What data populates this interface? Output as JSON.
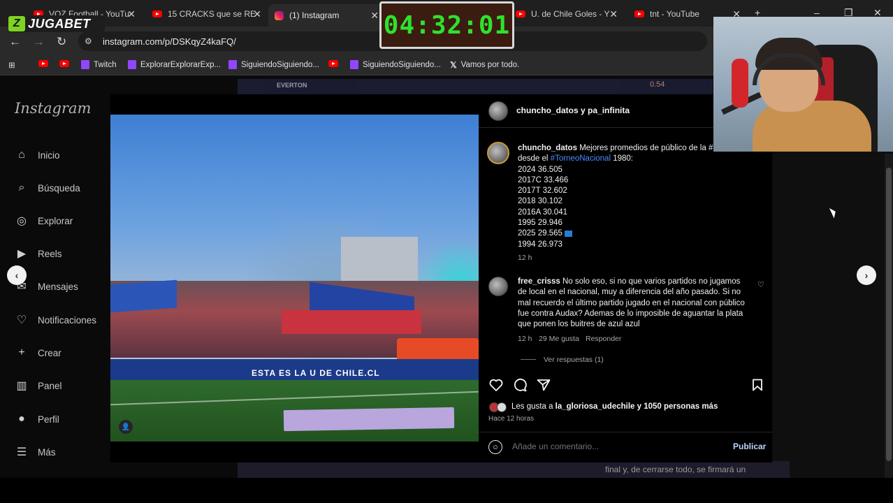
{
  "browser": {
    "tabs": [
      {
        "title": "VOZ Football - YouTu",
        "icon": "youtube-icon"
      },
      {
        "title": "15 CRACKS que se RE",
        "icon": "youtube-icon"
      },
      {
        "title": "(1) Instagram",
        "icon": "instagram-icon",
        "active": true
      },
      {
        "title": "U. de Chile Goles - Y",
        "icon": "youtube-icon"
      },
      {
        "title": "tnt - YouTube",
        "icon": "youtube-icon"
      }
    ],
    "url": "instagram.com/p/DSKqyZ4kaFQ/",
    "bookmarks": [
      {
        "label": "",
        "icon": "youtube-icon"
      },
      {
        "label": "",
        "icon": "youtube-icon"
      },
      {
        "label": "Twitch",
        "icon": "twitch-icon"
      },
      {
        "label": "ExplorarExplorarExp...",
        "icon": "twitch-icon"
      },
      {
        "label": "SiguiendoSiguiendo...",
        "icon": "twitch-icon"
      },
      {
        "label": "",
        "icon": "youtube-icon"
      },
      {
        "label": "SiguiendoSiguiendo...",
        "icon": "twitch-icon"
      },
      {
        "label": "Vamos por todo.",
        "icon": "x-icon"
      }
    ]
  },
  "overlay": {
    "brand": "JUGABET",
    "timer": "04:32:01"
  },
  "sidebar": {
    "logo": "Instagram",
    "items": [
      {
        "label": "Inicio",
        "icon": "home-icon"
      },
      {
        "label": "Búsqueda",
        "icon": "search-icon"
      },
      {
        "label": "Explorar",
        "icon": "compass-icon"
      },
      {
        "label": "Reels",
        "icon": "reels-icon"
      },
      {
        "label": "Mensajes",
        "icon": "messages-icon"
      },
      {
        "label": "Notificaciones",
        "icon": "heart-icon"
      },
      {
        "label": "Crear",
        "icon": "plus-icon"
      },
      {
        "label": "Panel",
        "icon": "chart-icon"
      },
      {
        "label": "Perfil",
        "icon": "profile-icon"
      },
      {
        "label": "Más",
        "icon": "menu-icon"
      }
    ]
  },
  "post": {
    "header_name": "chuncho_datos y pa_infinita",
    "caption": {
      "user": "chuncho_datos",
      "text_1": "Mejores promedios de público de la",
      "tag": "#",
      "text_2": "desde el",
      "hashtag": "#TorneoNacional",
      "text_3": "1980:",
      "lines": [
        "2024 36.505",
        "2017C 33.466",
        "2017T 32.602",
        "2018 30.102",
        "2016A 30.041",
        "1995 29.946",
        "2025 29.565",
        "1994 26.973"
      ],
      "time": "12 h"
    },
    "comment": {
      "user": "free_crisss",
      "text": "No solo eso, si no que varios partidos no jugamos de local en el nacional, muy a diferencia del año pasado. Si no mal recuerdo el último partido jugado en el nacional con público fue contra Audax? Ademas de lo imposible de aguantar la plata que ponen los buitres de azul azul",
      "time": "12 h",
      "likes": "29 Me gusta",
      "reply": "Responder",
      "view_replies": "Ver respuestas (1)"
    },
    "likes_prefix": "Les gusta a",
    "likes_user": "la_gloriosa_udechile",
    "likes_suffix": "y 1050 personas más",
    "time_ago": "Hace 12 horas",
    "comment_placeholder": "Añade un comentario...",
    "publish": "Publicar",
    "photo_text": "ESTA ES LA U DE CHILE.CL"
  },
  "background": {
    "top_strip": "EVERTON",
    "top_score": "0.54",
    "bottom_text": "final y, de cerrarse todo, se firmará un"
  }
}
